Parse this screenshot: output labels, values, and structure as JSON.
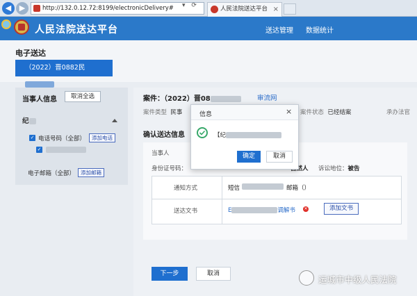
{
  "browser": {
    "url": "http://132.0.12.72:8199/electronicDelivery#",
    "tab_title": "人民法院送达平台",
    "tools": "▾ ⟳"
  },
  "app": {
    "title": "人民法院送达平台",
    "nav": [
      "送达管理",
      "数据统计"
    ]
  },
  "page": {
    "title": "电子送达",
    "case_tab_prefix": "（2022）晋0882民"
  },
  "left_panel": {
    "title": "当事人信息",
    "clear_all_label": "取消全选",
    "party_name": "纪",
    "phone_label": "电话号码（全部）",
    "add_phone_label": "添加电话",
    "email_label": "电子邮箱（全部）",
    "add_email_label": "添加邮箱"
  },
  "main": {
    "case_label": "案件：（2022）晋08",
    "case_link": "审流网",
    "meta": {
      "type_label": "案件类型",
      "type_value": "民事",
      "status_label": "案件状态",
      "status_value": "已经结案",
      "judge_label": "承办法官"
    },
    "section_title": "确认送达信息",
    "party_prefix": "当事人",
    "id_label": "身份证号码：",
    "natural_person": "自然人",
    "role_label": "诉讼地位：",
    "role_value": "被告",
    "rows": [
      {
        "label": "通知方式",
        "value": "短信",
        "value2": "邮箱（）"
      },
      {
        "label": "送达文书",
        "doc_prefix": "E",
        "doc_suffix": "调解书",
        "add_doc_label": "添加文书"
      }
    ],
    "next_label": "下一步",
    "cancel_label": "取消"
  },
  "modal": {
    "title": "信息",
    "message_prefix": "【纪",
    "ok_label": "确定",
    "cancel_label": "取消"
  },
  "watermark": {
    "text": "运城市中级人民法院"
  },
  "colors": {
    "header_blue": "#2b79c9",
    "primary_button": "#1f6fcf",
    "success_green": "#38a86a",
    "delete_red": "#e0302a"
  }
}
